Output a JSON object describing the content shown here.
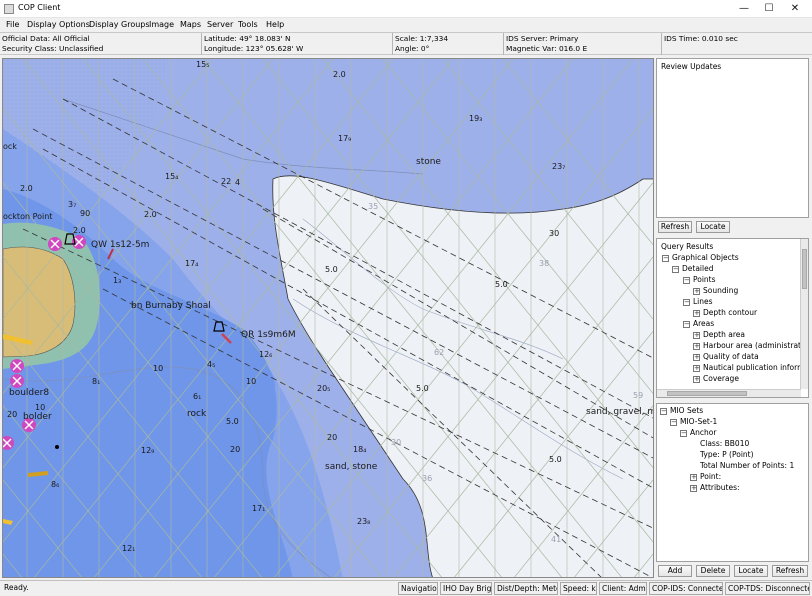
{
  "window": {
    "title": "COP Client"
  },
  "menu": [
    "File",
    "Display Options",
    "Display Groups",
    "Image",
    "Maps",
    "Server",
    "Tools",
    "Help"
  ],
  "info": {
    "official_data": "Official Data: All Official",
    "security_class": "Security Class: Unclassified",
    "latitude": "Latitude: 49° 18.083' N",
    "longitude": "Longitude: 123° 05.628' W",
    "scale": "Scale:  1:7,334",
    "angle": "Angle: 0°",
    "ids_server": "IDS Server: Primary",
    "magnetic_var": "Magnetic Var: 016.0 E",
    "ids_time": "IDS Time: 0.010 sec"
  },
  "map": {
    "labels": {
      "rock": "ock",
      "rockton_point": "ockton Point",
      "qw": "QW 1s12-5m",
      "burnaby": "bn Burnaby Shoal",
      "qr": "QR 1s9m6M",
      "stone": "stone",
      "sand_gravel": "sand, gravel, mu",
      "sand_stone": "sand, stone",
      "rock2": "rock",
      "boulder8": "boulder8",
      "boulder": "bolder"
    },
    "depths": [
      {
        "t": "15₅"
      },
      {
        "t": "2.0"
      },
      {
        "t": "17₉"
      },
      {
        "t": "19₃"
      },
      {
        "t": "23₇"
      },
      {
        "t": "15₄"
      },
      {
        "t": "22"
      },
      {
        "t": "4"
      },
      {
        "t": "3₇"
      },
      {
        "t": "2.0"
      },
      {
        "t": "90"
      },
      {
        "t": "2.0"
      },
      {
        "t": "2.0"
      },
      {
        "t": "17₄"
      },
      {
        "t": "5.0"
      },
      {
        "t": "5.0"
      },
      {
        "t": "30"
      },
      {
        "t": "5.0"
      },
      {
        "t": "10"
      },
      {
        "t": "4₅"
      },
      {
        "t": "12₆"
      },
      {
        "t": "10"
      },
      {
        "t": "6₁"
      },
      {
        "t": "8₁"
      },
      {
        "t": "20₅"
      },
      {
        "t": "5.0"
      },
      {
        "t": "20"
      },
      {
        "t": "18₄"
      },
      {
        "t": "12₉"
      },
      {
        "t": "5.0"
      },
      {
        "t": "20"
      },
      {
        "t": "8₆"
      },
      {
        "t": "17₁"
      },
      {
        "t": "23₈"
      },
      {
        "t": "12₁"
      },
      {
        "t": "10"
      },
      {
        "t": "20"
      },
      {
        "t": "1₃"
      }
    ],
    "faint_depths": [
      "35",
      "38",
      "62",
      "59",
      "30",
      "36",
      "41"
    ]
  },
  "review": {
    "title": "Review Updates",
    "refresh": "Refresh",
    "locate": "Locate"
  },
  "query": {
    "title": "Query Results",
    "rows": [
      "Graphical Objects",
      "Detailed",
      "Points",
      "Sounding",
      "Lines",
      "Depth contour",
      "Areas",
      "Depth area",
      "Harbour area (administrative)",
      "Quality of data",
      "Nautical publication information",
      "Coverage"
    ]
  },
  "mio": {
    "rows": [
      "MIO Sets",
      "MIO-Set-1",
      "Anchor",
      "Class: BB010",
      "Type: P (Point)",
      "Total Number of Points: 1",
      "Point:",
      "Attributes:"
    ],
    "add": "Add",
    "delete": "Delete",
    "locate": "Locate",
    "refresh": "Refresh"
  },
  "status": {
    "ready": "Ready.",
    "navigation": "Navigation",
    "iho": "IHO Day Bright",
    "dist": "Dist/Depth: Meters",
    "speed": "Speed: kn",
    "client": "Client: Admin",
    "cop_ids": "COP-IDS: Connected",
    "cop_tds": "COP-TDS: Disconnected"
  },
  "colors": {
    "shallow": "#6f96e8",
    "medium": "#9eb0ea",
    "deep": "#c6d2f1",
    "land": "#d8bd78",
    "very_shallow": "#8fc1ae",
    "shore": "#eef1f5"
  }
}
